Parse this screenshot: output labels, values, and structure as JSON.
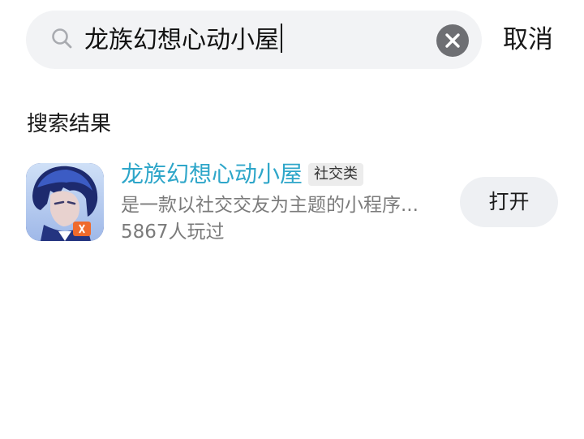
{
  "search": {
    "query": "龙族幻想心动小屋",
    "icon": "search-icon",
    "clear_icon": "close-circle-icon",
    "cancel_label": "取消"
  },
  "results": {
    "section_title": "搜索结果",
    "items": [
      {
        "name": "龙族幻想心动小屋",
        "category": "社交类",
        "description": "是一款以社交交友为主题的小程序...",
        "play_count": "5867人玩过",
        "open_label": "打开",
        "icon": "game-avatar-icon"
      }
    ]
  },
  "colors": {
    "accent": "#2ea6c9",
    "search_bg": "#f2f3f5",
    "secondary_text": "#7b7b7b",
    "button_bg": "#eef0f3"
  }
}
